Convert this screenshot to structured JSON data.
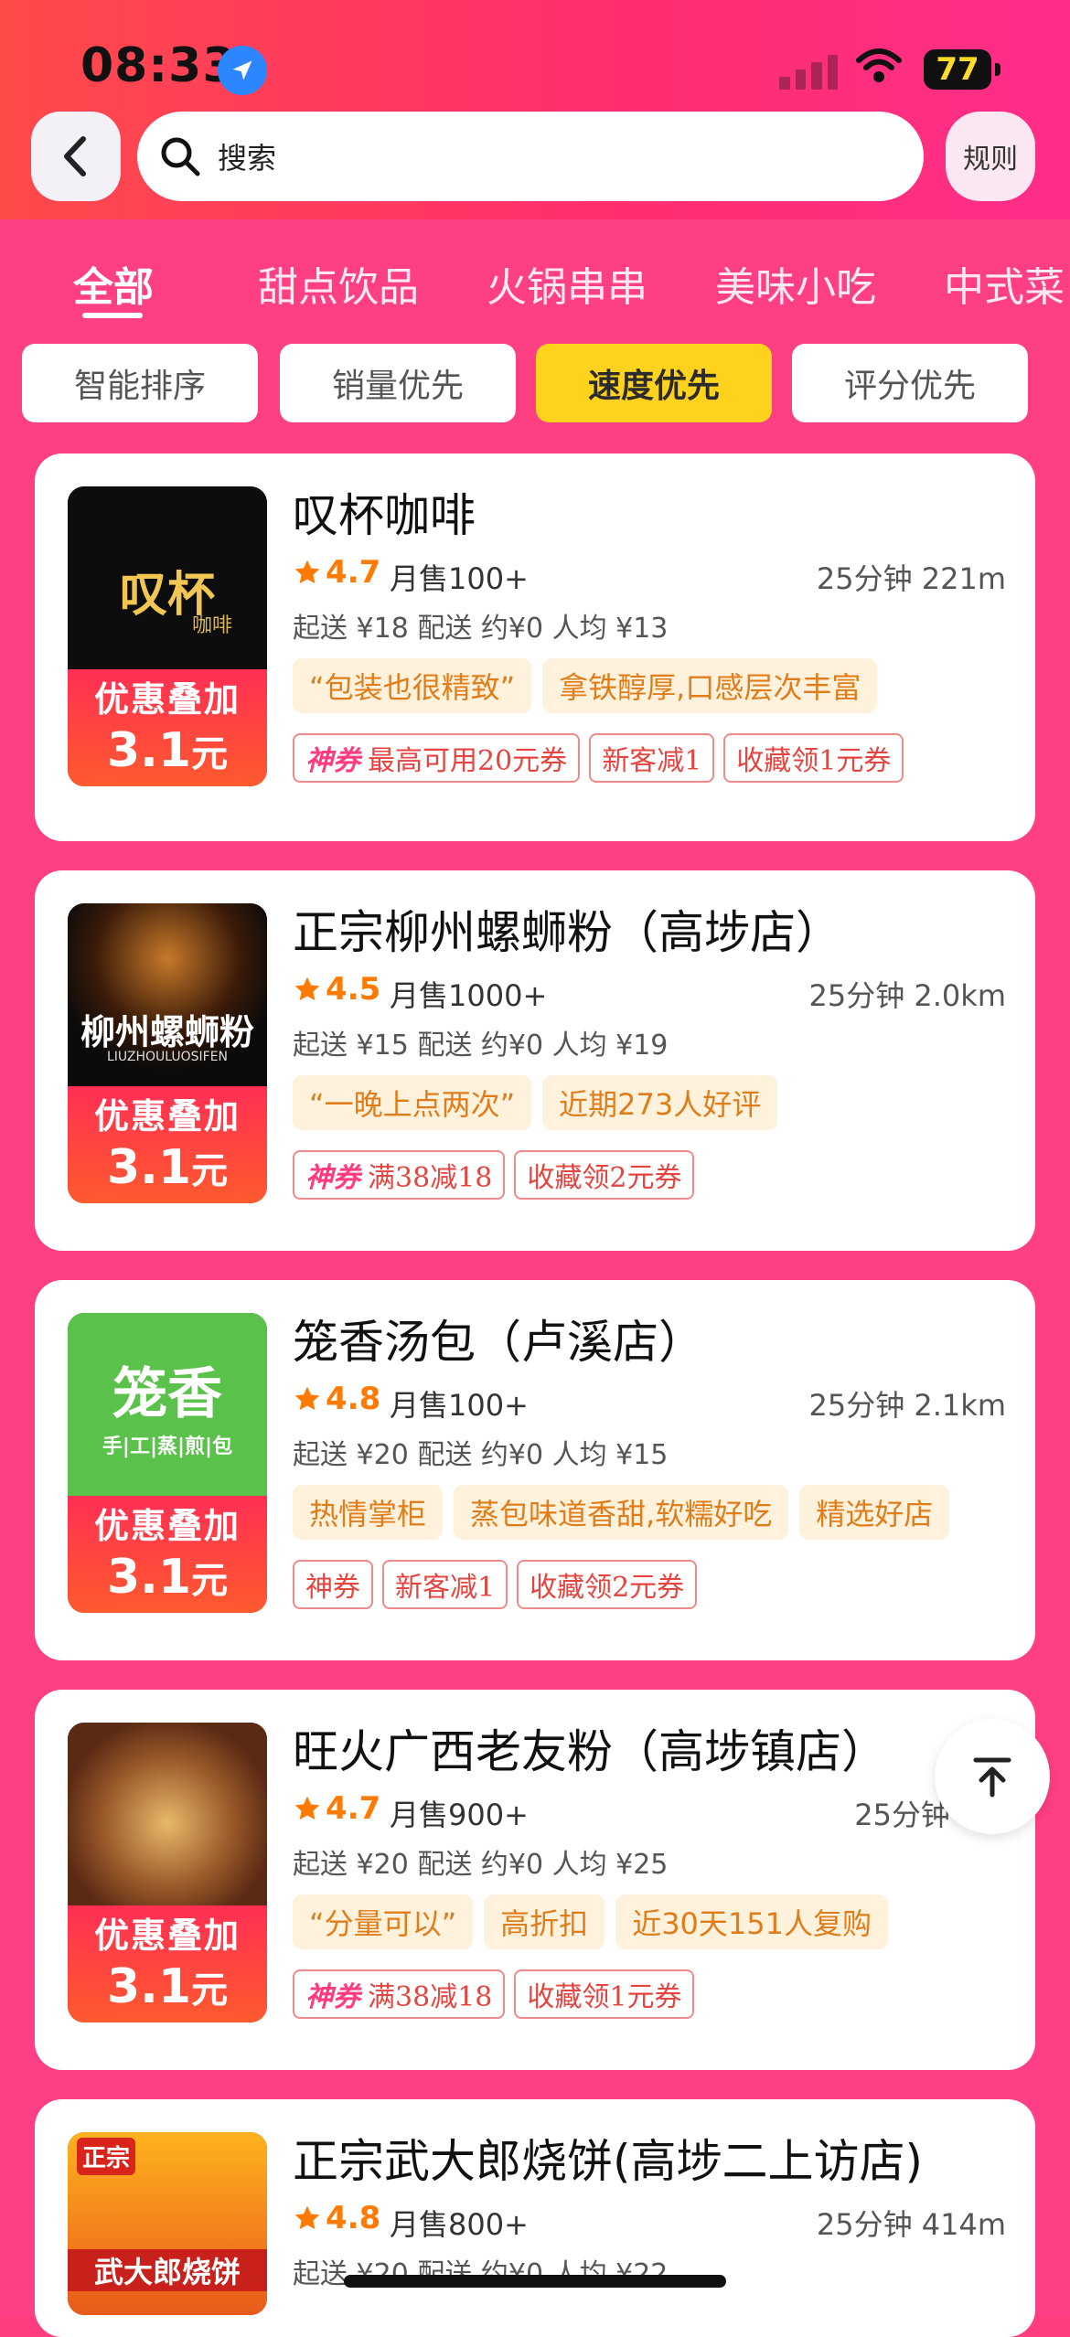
{
  "status_bar": {
    "time": "08:33",
    "battery": "77"
  },
  "header": {
    "search_placeholder": "搜索",
    "rules_label": "规则"
  },
  "categories": [
    "全部",
    "甜点饮品",
    "火锅串串",
    "美味小吃",
    "中式菜"
  ],
  "sort_options": [
    "智能排序",
    "销量优先",
    "速度优先",
    "评分优先"
  ],
  "active_sort": "速度优先",
  "promo": {
    "line1": "优惠叠加",
    "amount": "3.1",
    "unit": "元"
  },
  "stores": [
    {
      "name": "叹杯咖啡",
      "rating": "4.7",
      "sales": "月售100+",
      "eta": "25分钟 221m",
      "fees": "起送 ¥18 配送 约¥0 人均 ¥13",
      "tags": [
        "“包装也很精致”",
        "拿铁醇厚,口感层次丰富"
      ],
      "coupons": [
        "最高可用20元券",
        "新客减1",
        "收藏领1元券"
      ],
      "pic_text": "叹杯",
      "pic_sub": "咖啡"
    },
    {
      "name": "正宗柳州螺蛳粉（高埗店）",
      "rating": "4.5",
      "sales": "月售1000+",
      "eta": "25分钟 2.0km",
      "fees": "起送 ¥15 配送 约¥0 人均 ¥19",
      "tags": [
        "“一晚上点两次”",
        "近期273人好评"
      ],
      "coupons": [
        "满38减18",
        "收藏领2元券"
      ],
      "pic_text": "柳州螺蛳粉",
      "pic_sub": "LIUZHOULUOSIFEN"
    },
    {
      "name": "笼香汤包（卢溪店）",
      "rating": "4.8",
      "sales": "月售100+",
      "eta": "25分钟 2.1km",
      "fees": "起送 ¥20 配送 约¥0 人均 ¥15",
      "tags": [
        "热情掌柜",
        "蒸包味道香甜,软糯好吃",
        "精选好店"
      ],
      "coupons": [
        "神券",
        "新客减1",
        "收藏领2元券"
      ],
      "pic_text": "笼香",
      "pic_sub": "手|工|蒸|煎|包"
    },
    {
      "name": "旺火广西老友粉（高埗镇店）",
      "rating": "4.7",
      "sales": "月售900+",
      "eta": "25分钟 1.9",
      "fees": "起送 ¥20 配送 约¥0 人均 ¥25",
      "tags": [
        "“分量可以”",
        "高折扣",
        "近30天151人复购"
      ],
      "coupons": [
        "满38减18",
        "收藏领1元券"
      ]
    },
    {
      "name": "正宗武大郎烧饼(高埗二上访店)",
      "rating": "4.8",
      "sales": "月售800+",
      "eta": "25分钟 414m",
      "fees": "起送 ¥20 配送 约¥0 人均 ¥22",
      "pic_text": "武大郎烧饼",
      "pic_sub": "正宗"
    }
  ],
  "shenquan_label": "神券",
  "colors": {
    "accent": "#ff3f83",
    "active_chip": "#ffd21e",
    "rating": "#ff7a00"
  }
}
